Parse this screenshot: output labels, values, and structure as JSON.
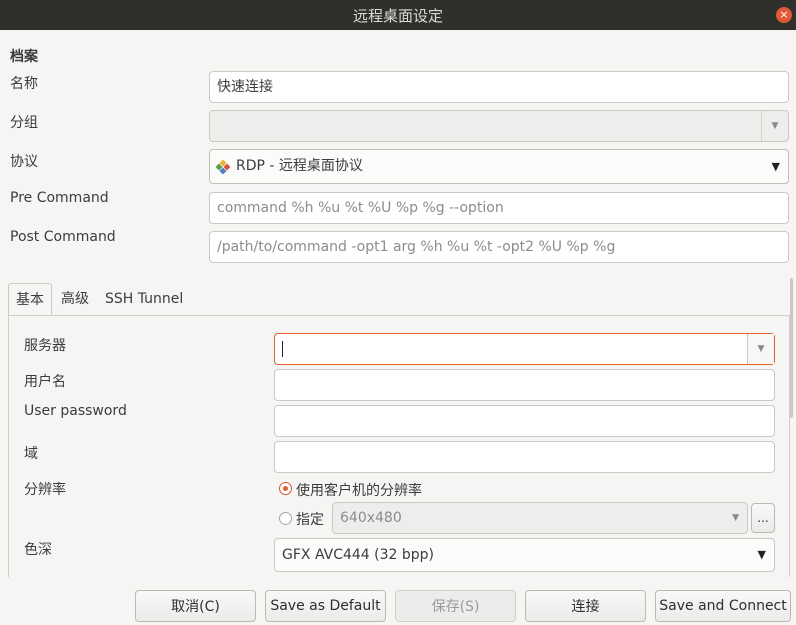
{
  "window": {
    "title": "远程桌面设定",
    "close_glyph": "×"
  },
  "profile": {
    "section_label": "档案",
    "name_label": "名称",
    "name_value": "快速连接",
    "group_label": "分组",
    "group_value": "",
    "protocol_label": "协议",
    "protocol_value": "RDP - 远程桌面协议",
    "pre_command_label": "Pre Command",
    "pre_command_placeholder": "command %h %u %t %U %p %g --option",
    "post_command_label": "Post Command",
    "post_command_placeholder": "/path/to/command -opt1 arg %h %u %t -opt2 %U %p %g"
  },
  "tabs": [
    {
      "label": "基本",
      "active": true
    },
    {
      "label": "高级",
      "active": false
    },
    {
      "label": "SSH Tunnel",
      "active": false
    }
  ],
  "basic": {
    "server_label": "服务器",
    "server_value": "",
    "username_label": "用户名",
    "username_value": "",
    "password_label": "User password",
    "password_value": "",
    "domain_label": "域",
    "domain_value": "",
    "resolution_label": "分辨率",
    "resolution_client_option": "使用客户机的分辨率",
    "resolution_custom_option": "指定",
    "resolution_custom_value": "640x480",
    "resolution_more_button": "...",
    "color_depth_label": "色深",
    "color_depth_value": "GFX AVC444 (32 bpp)"
  },
  "buttons": {
    "cancel": "取消(C)",
    "save_default": "Save as Default",
    "save": "保存(S)",
    "connect": "连接",
    "save_connect": "Save and Connect"
  },
  "colors": {
    "accent": "#e2622d",
    "titlebar": "#2f2f2b",
    "window_bg": "#f5f5f4"
  },
  "icons": {
    "protocol_icon": "rdp-protocol-icon",
    "dropdown": "chevron-down-icon"
  }
}
